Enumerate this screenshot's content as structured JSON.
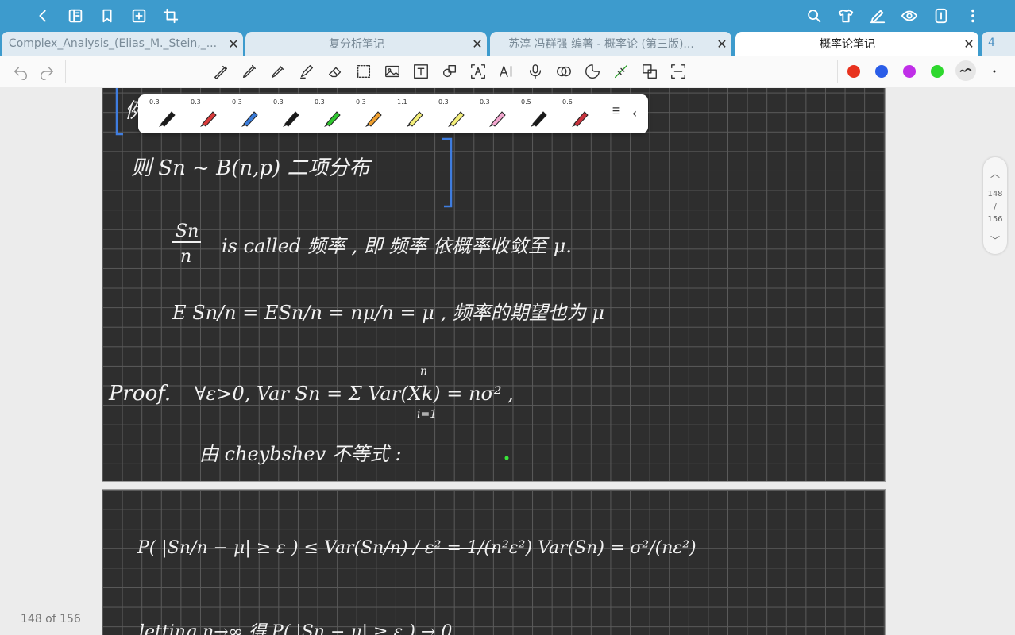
{
  "tabs": [
    {
      "label": "Complex_Analysis_(Elias_M._Stein,_...",
      "active": false
    },
    {
      "label": "复分析笔记",
      "active": false
    },
    {
      "label": "苏淳 冯群强 编著 - 概率论 (第三版)...",
      "active": false
    },
    {
      "label": "概率论笔记",
      "active": true
    }
  ],
  "tab_count": "4",
  "close_glyph": "✕",
  "pen_palette": {
    "sizes": [
      "0.3",
      "0.3",
      "0.3",
      "0.3",
      "0.3",
      "0.3",
      "1.1",
      "0.3",
      "0.3",
      "0.5",
      "0.6"
    ],
    "colors": [
      "#1a1a1a",
      "#d83a3a",
      "#3a7bd8",
      "#1a1a1a",
      "#2fc72f",
      "#f0a030",
      "#f4ef7a",
      "#f4ef7a",
      "#f3a6cf",
      "#1a1a1a",
      "#c8323c"
    ],
    "collapse_glyph": "‹"
  },
  "quick_colors": [
    "#e8321e",
    "#2a5de8",
    "#c02ee8",
    "#2ed82e"
  ],
  "note": {
    "line_example": "例",
    "line1": "则 Sn ~ B(n,p) 二项分布",
    "line2_frac_num": "Sn",
    "line2_frac_den": "n",
    "line2_text": "is called 频率 , 即 频率 依概率收敛至 μ.",
    "line3": "E Sn/n = ESn/n = nμ/n = μ ,  频率的期望也为 μ",
    "line4_proof": "Proof.",
    "line4_rest": "∀ε>0,   Var Sn = Σ Var(Xk) = nσ² ,",
    "line4_sum_top": "n",
    "line4_sum_bottom": "i=1",
    "line5": "由 cheybshev 不等式 :",
    "page2_line1": "P( |Sn/n − μ| ≥ ε )  ≤  Var(Sn/n) / ε²  =  1/(n²ε²) Var(Sn)  =  σ²/(nε²)",
    "page2_line2": "letting n→∞ 得 P( |Sn − μ| ≥ ε ) → 0"
  },
  "scroller": {
    "current": "148",
    "sep": "/",
    "total": "156"
  },
  "page_indicator": "148 of 156"
}
